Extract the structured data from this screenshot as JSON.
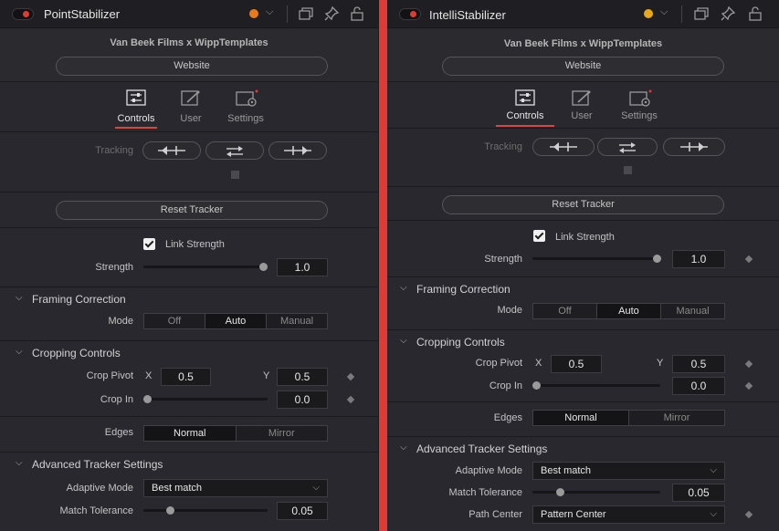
{
  "colors": {
    "accent": "#e03a35",
    "left_status_dot": "#e87a1a",
    "right_status_dot": "#e8a81a"
  },
  "left": {
    "title": "PointStabilizer",
    "brand": "Van Beek Films x WippTemplates",
    "website_label": "Website",
    "tabs": [
      "Controls",
      "User",
      "Settings"
    ],
    "tracking_label": "Tracking",
    "reset_tracker_label": "Reset Tracker",
    "link_strength_label": "Link Strength",
    "strength_label": "Strength",
    "strength_value": "1.0",
    "framing_title": "Framing Correction",
    "mode_label": "Mode",
    "mode_options": [
      "Off",
      "Auto",
      "Manual"
    ],
    "cropping_title": "Cropping Controls",
    "crop_pivot_label": "Crop Pivot",
    "x_label": "X",
    "y_label": "Y",
    "crop_pivot_x": "0.5",
    "crop_pivot_y": "0.5",
    "crop_in_label": "Crop In",
    "crop_in_value": "0.0",
    "edges_label": "Edges",
    "edges_options": [
      "Normal",
      "Mirror"
    ],
    "advanced_title": "Advanced Tracker Settings",
    "adaptive_mode_label": "Adaptive Mode",
    "adaptive_mode_value": "Best match",
    "match_tolerance_label": "Match Tolerance",
    "match_tolerance_value": "0.05"
  },
  "right": {
    "title": "IntelliStabilizer",
    "brand": "Van Beek Films x WippTemplates",
    "website_label": "Website",
    "tabs": [
      "Controls",
      "User",
      "Settings"
    ],
    "tracking_label": "Tracking",
    "reset_tracker_label": "Reset Tracker",
    "link_strength_label": "Link Strength",
    "strength_label": "Strength",
    "strength_value": "1.0",
    "framing_title": "Framing Correction",
    "mode_label": "Mode",
    "mode_options": [
      "Off",
      "Auto",
      "Manual"
    ],
    "cropping_title": "Cropping Controls",
    "crop_pivot_label": "Crop Pivot",
    "x_label": "X",
    "y_label": "Y",
    "crop_pivot_x": "0.5",
    "crop_pivot_y": "0.5",
    "crop_in_label": "Crop In",
    "crop_in_value": "0.0",
    "edges_label": "Edges",
    "edges_options": [
      "Normal",
      "Mirror"
    ],
    "advanced_title": "Advanced Tracker Settings",
    "adaptive_mode_label": "Adaptive Mode",
    "adaptive_mode_value": "Best match",
    "match_tolerance_label": "Match Tolerance",
    "match_tolerance_value": "0.05",
    "path_center_label": "Path Center",
    "path_center_value": "Pattern Center"
  }
}
